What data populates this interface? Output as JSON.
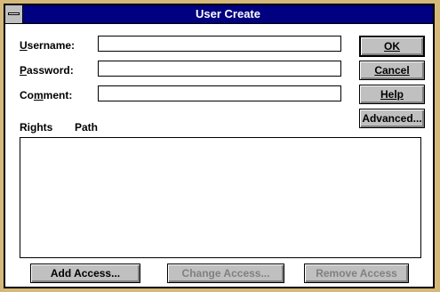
{
  "window": {
    "title": "User Create"
  },
  "form": {
    "username_label": "Username:",
    "password_label": "Password:",
    "comment_label": "Comment:",
    "username_value": "",
    "password_value": "",
    "comment_value": ""
  },
  "buttons": {
    "ok": "OK",
    "cancel": "Cancel",
    "help": "Help",
    "advanced": "Advanced...",
    "add_access": "Add Access...",
    "change_access": "Change Access...",
    "remove_access": "Remove Access"
  },
  "list": {
    "rights_header": "Rights",
    "path_header": "Path",
    "items": []
  },
  "colors": {
    "titlebar": "#000080",
    "desktop": "#d6b97a",
    "button_face": "#c0c0c0",
    "disabled_text": "#808080"
  },
  "icons": {
    "system_menu": "system-menu-icon"
  }
}
